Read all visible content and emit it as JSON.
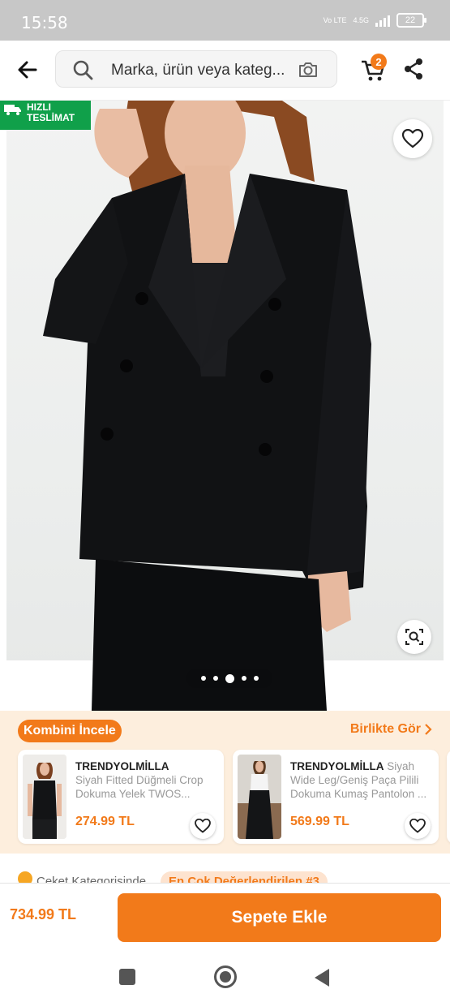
{
  "status_bar": {
    "time": "15:58",
    "network": "4.5G",
    "volte": "Vo LTE",
    "battery": "22"
  },
  "header": {
    "search_placeholder": "Marka, ürün veya kateg...",
    "cart_count": "2"
  },
  "product": {
    "fast_delivery_line1": "HIZLI",
    "fast_delivery_line2": "TESLİMAT",
    "gallery": {
      "total": 5,
      "active_index": 2
    }
  },
  "combo": {
    "title": "Kombini İncele",
    "link": "Birlikte Gör",
    "items": [
      {
        "brand": "TRENDYOLMİLLA",
        "desc": "Siyah Fitted Düğmeli Crop Dokuma Yelek TWOS...",
        "price": "274.99 TL"
      },
      {
        "brand": "TRENDYOLMİLLA",
        "desc": "Siyah Wide Leg/Geniş Paça Pilili Dokuma Kumaş Pantolon ...",
        "price": "569.99 TL"
      }
    ]
  },
  "category": {
    "prefix": "Ceket Kategorisinde",
    "highlight": "En Çok Değerlendirilen #3"
  },
  "bottom": {
    "price": "734.99 TL",
    "add_to_cart": "Sepete Ekle"
  },
  "colors": {
    "brand_orange": "#f27a1a",
    "fast_green": "#10a04a",
    "combo_bg": "#fdeedd"
  }
}
